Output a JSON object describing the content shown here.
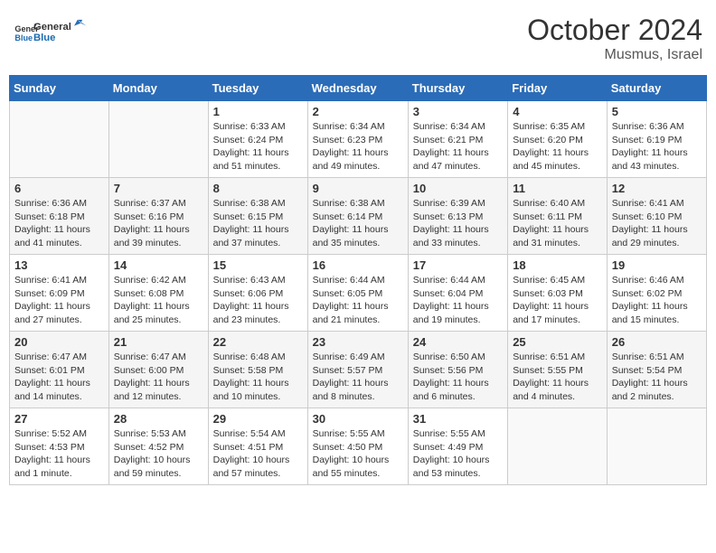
{
  "header": {
    "logo_general": "General",
    "logo_blue": "Blue",
    "month": "October 2024",
    "location": "Musmus, Israel"
  },
  "columns": [
    "Sunday",
    "Monday",
    "Tuesday",
    "Wednesday",
    "Thursday",
    "Friday",
    "Saturday"
  ],
  "weeks": [
    [
      {
        "day": "",
        "sunrise": "",
        "sunset": "",
        "daylight": ""
      },
      {
        "day": "",
        "sunrise": "",
        "sunset": "",
        "daylight": ""
      },
      {
        "day": "1",
        "sunrise": "Sunrise: 6:33 AM",
        "sunset": "Sunset: 6:24 PM",
        "daylight": "Daylight: 11 hours and 51 minutes."
      },
      {
        "day": "2",
        "sunrise": "Sunrise: 6:34 AM",
        "sunset": "Sunset: 6:23 PM",
        "daylight": "Daylight: 11 hours and 49 minutes."
      },
      {
        "day": "3",
        "sunrise": "Sunrise: 6:34 AM",
        "sunset": "Sunset: 6:21 PM",
        "daylight": "Daylight: 11 hours and 47 minutes."
      },
      {
        "day": "4",
        "sunrise": "Sunrise: 6:35 AM",
        "sunset": "Sunset: 6:20 PM",
        "daylight": "Daylight: 11 hours and 45 minutes."
      },
      {
        "day": "5",
        "sunrise": "Sunrise: 6:36 AM",
        "sunset": "Sunset: 6:19 PM",
        "daylight": "Daylight: 11 hours and 43 minutes."
      }
    ],
    [
      {
        "day": "6",
        "sunrise": "Sunrise: 6:36 AM",
        "sunset": "Sunset: 6:18 PM",
        "daylight": "Daylight: 11 hours and 41 minutes."
      },
      {
        "day": "7",
        "sunrise": "Sunrise: 6:37 AM",
        "sunset": "Sunset: 6:16 PM",
        "daylight": "Daylight: 11 hours and 39 minutes."
      },
      {
        "day": "8",
        "sunrise": "Sunrise: 6:38 AM",
        "sunset": "Sunset: 6:15 PM",
        "daylight": "Daylight: 11 hours and 37 minutes."
      },
      {
        "day": "9",
        "sunrise": "Sunrise: 6:38 AM",
        "sunset": "Sunset: 6:14 PM",
        "daylight": "Daylight: 11 hours and 35 minutes."
      },
      {
        "day": "10",
        "sunrise": "Sunrise: 6:39 AM",
        "sunset": "Sunset: 6:13 PM",
        "daylight": "Daylight: 11 hours and 33 minutes."
      },
      {
        "day": "11",
        "sunrise": "Sunrise: 6:40 AM",
        "sunset": "Sunset: 6:11 PM",
        "daylight": "Daylight: 11 hours and 31 minutes."
      },
      {
        "day": "12",
        "sunrise": "Sunrise: 6:41 AM",
        "sunset": "Sunset: 6:10 PM",
        "daylight": "Daylight: 11 hours and 29 minutes."
      }
    ],
    [
      {
        "day": "13",
        "sunrise": "Sunrise: 6:41 AM",
        "sunset": "Sunset: 6:09 PM",
        "daylight": "Daylight: 11 hours and 27 minutes."
      },
      {
        "day": "14",
        "sunrise": "Sunrise: 6:42 AM",
        "sunset": "Sunset: 6:08 PM",
        "daylight": "Daylight: 11 hours and 25 minutes."
      },
      {
        "day": "15",
        "sunrise": "Sunrise: 6:43 AM",
        "sunset": "Sunset: 6:06 PM",
        "daylight": "Daylight: 11 hours and 23 minutes."
      },
      {
        "day": "16",
        "sunrise": "Sunrise: 6:44 AM",
        "sunset": "Sunset: 6:05 PM",
        "daylight": "Daylight: 11 hours and 21 minutes."
      },
      {
        "day": "17",
        "sunrise": "Sunrise: 6:44 AM",
        "sunset": "Sunset: 6:04 PM",
        "daylight": "Daylight: 11 hours and 19 minutes."
      },
      {
        "day": "18",
        "sunrise": "Sunrise: 6:45 AM",
        "sunset": "Sunset: 6:03 PM",
        "daylight": "Daylight: 11 hours and 17 minutes."
      },
      {
        "day": "19",
        "sunrise": "Sunrise: 6:46 AM",
        "sunset": "Sunset: 6:02 PM",
        "daylight": "Daylight: 11 hours and 15 minutes."
      }
    ],
    [
      {
        "day": "20",
        "sunrise": "Sunrise: 6:47 AM",
        "sunset": "Sunset: 6:01 PM",
        "daylight": "Daylight: 11 hours and 14 minutes."
      },
      {
        "day": "21",
        "sunrise": "Sunrise: 6:47 AM",
        "sunset": "Sunset: 6:00 PM",
        "daylight": "Daylight: 11 hours and 12 minutes."
      },
      {
        "day": "22",
        "sunrise": "Sunrise: 6:48 AM",
        "sunset": "Sunset: 5:58 PM",
        "daylight": "Daylight: 11 hours and 10 minutes."
      },
      {
        "day": "23",
        "sunrise": "Sunrise: 6:49 AM",
        "sunset": "Sunset: 5:57 PM",
        "daylight": "Daylight: 11 hours and 8 minutes."
      },
      {
        "day": "24",
        "sunrise": "Sunrise: 6:50 AM",
        "sunset": "Sunset: 5:56 PM",
        "daylight": "Daylight: 11 hours and 6 minutes."
      },
      {
        "day": "25",
        "sunrise": "Sunrise: 6:51 AM",
        "sunset": "Sunset: 5:55 PM",
        "daylight": "Daylight: 11 hours and 4 minutes."
      },
      {
        "day": "26",
        "sunrise": "Sunrise: 6:51 AM",
        "sunset": "Sunset: 5:54 PM",
        "daylight": "Daylight: 11 hours and 2 minutes."
      }
    ],
    [
      {
        "day": "27",
        "sunrise": "Sunrise: 5:52 AM",
        "sunset": "Sunset: 4:53 PM",
        "daylight": "Daylight: 11 hours and 1 minute."
      },
      {
        "day": "28",
        "sunrise": "Sunrise: 5:53 AM",
        "sunset": "Sunset: 4:52 PM",
        "daylight": "Daylight: 10 hours and 59 minutes."
      },
      {
        "day": "29",
        "sunrise": "Sunrise: 5:54 AM",
        "sunset": "Sunset: 4:51 PM",
        "daylight": "Daylight: 10 hours and 57 minutes."
      },
      {
        "day": "30",
        "sunrise": "Sunrise: 5:55 AM",
        "sunset": "Sunset: 4:50 PM",
        "daylight": "Daylight: 10 hours and 55 minutes."
      },
      {
        "day": "31",
        "sunrise": "Sunrise: 5:55 AM",
        "sunset": "Sunset: 4:49 PM",
        "daylight": "Daylight: 10 hours and 53 minutes."
      },
      {
        "day": "",
        "sunrise": "",
        "sunset": "",
        "daylight": ""
      },
      {
        "day": "",
        "sunrise": "",
        "sunset": "",
        "daylight": ""
      }
    ]
  ]
}
